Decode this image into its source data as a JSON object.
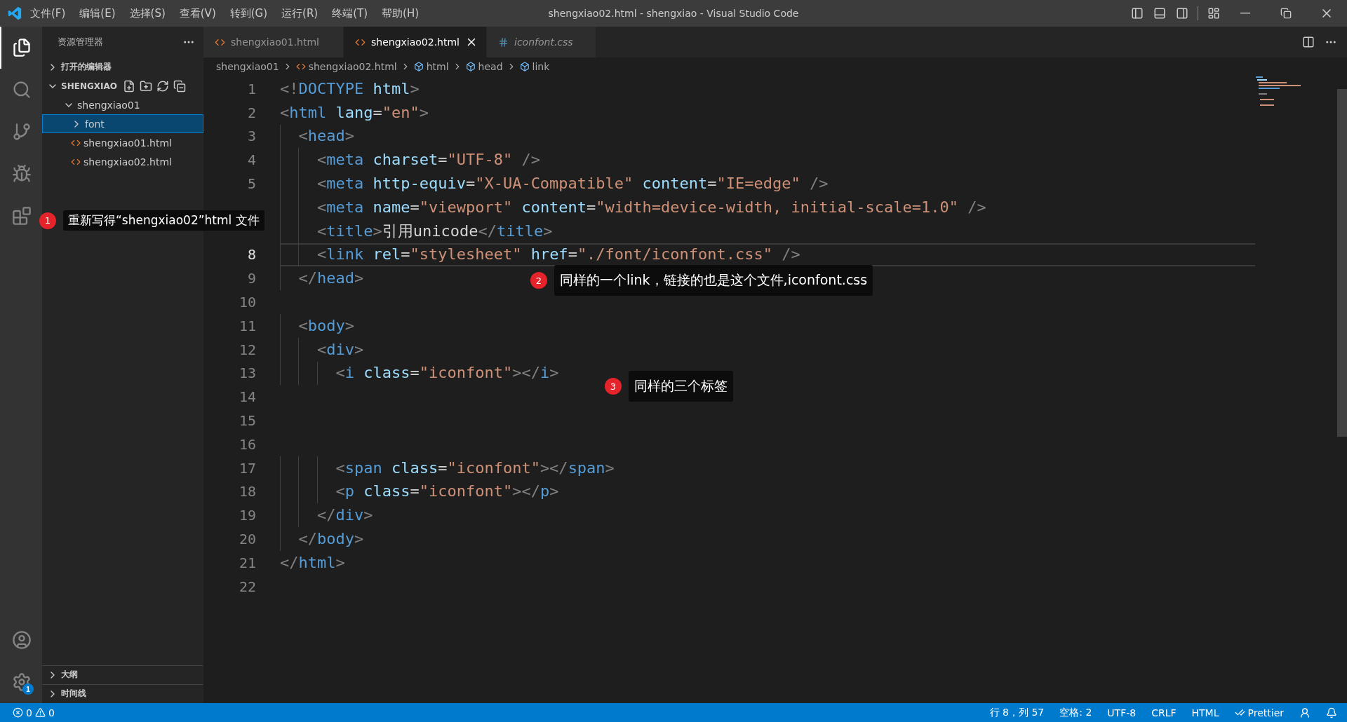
{
  "window": {
    "title": "shengxiao02.html - shengxiao - Visual Studio Code"
  },
  "menu": [
    "文件(F)",
    "编辑(E)",
    "选择(S)",
    "查看(V)",
    "转到(G)",
    "运行(R)",
    "终端(T)",
    "帮助(H)"
  ],
  "activity_bar": {
    "settings_badge": "1"
  },
  "sidebar": {
    "title": "资源管理器",
    "open_editors": {
      "label": "打开的编辑器",
      "expanded": false
    },
    "workspace": {
      "label": "SHENGXIAO",
      "expanded": true,
      "tree": [
        {
          "label": "shengxiao01",
          "kind": "folder",
          "expanded": true,
          "selected": false,
          "children": [
            {
              "label": "font",
              "kind": "folder",
              "expanded": false,
              "selected": true
            },
            {
              "label": "shengxiao01.html",
              "kind": "file",
              "selected": false
            },
            {
              "label": "shengxiao02.html",
              "kind": "file",
              "selected": false
            }
          ]
        }
      ]
    },
    "bottom_sections": [
      {
        "label": "大纲",
        "expanded": false
      },
      {
        "label": "时间线",
        "expanded": false
      }
    ]
  },
  "tabs": [
    {
      "label": "shengxiao01.html",
      "kind": "html",
      "selected": false,
      "preview": false
    },
    {
      "label": "shengxiao02.html",
      "kind": "html",
      "selected": true,
      "preview": false
    },
    {
      "label": "iconfont.css",
      "kind": "css",
      "selected": false,
      "preview": true
    }
  ],
  "breadcrumb": [
    {
      "label": "shengxiao01",
      "kind": "folder"
    },
    {
      "label": "shengxiao02.html",
      "kind": "file"
    },
    {
      "label": "html",
      "kind": "symbol"
    },
    {
      "label": "head",
      "kind": "symbol"
    },
    {
      "label": "link",
      "kind": "symbol"
    }
  ],
  "code_lines": [
    {
      "number": "1",
      "current": false,
      "tokens": [
        {
          "kind": "punct",
          "text": "<!"
        },
        {
          "kind": "tag",
          "text": "DOCTYPE"
        },
        {
          "kind": "attr",
          "text": " html"
        },
        {
          "kind": "punct",
          "text": ">"
        }
      ]
    },
    {
      "number": "2",
      "current": false,
      "tokens": [
        {
          "kind": "punct",
          "text": "<"
        },
        {
          "kind": "tag",
          "text": "html"
        },
        {
          "kind": "attr",
          "text": " lang"
        },
        {
          "kind": "text",
          "text": "="
        },
        {
          "kind": "string",
          "text": "\"en\""
        },
        {
          "kind": "punct",
          "text": ">"
        }
      ]
    },
    {
      "number": "3",
      "current": false,
      "tokens": [
        {
          "kind": "punct",
          "text": "  <"
        },
        {
          "kind": "tag",
          "text": "head"
        },
        {
          "kind": "punct",
          "text": ">"
        }
      ]
    },
    {
      "number": "4",
      "current": false,
      "tokens": [
        {
          "kind": "punct",
          "text": "    <"
        },
        {
          "kind": "tag",
          "text": "meta"
        },
        {
          "kind": "attr",
          "text": " charset"
        },
        {
          "kind": "text",
          "text": "="
        },
        {
          "kind": "string",
          "text": "\"UTF-8\""
        },
        {
          "kind": "punct",
          "text": " />"
        }
      ]
    },
    {
      "number": "5",
      "current": false,
      "tokens": [
        {
          "kind": "punct",
          "text": "    <"
        },
        {
          "kind": "tag",
          "text": "meta"
        },
        {
          "kind": "attr",
          "text": " http-equiv"
        },
        {
          "kind": "text",
          "text": "="
        },
        {
          "kind": "string",
          "text": "\"X-UA-Compatible\""
        },
        {
          "kind": "attr",
          "text": " content"
        },
        {
          "kind": "text",
          "text": "="
        },
        {
          "kind": "string",
          "text": "\"IE=edge\""
        },
        {
          "kind": "punct",
          "text": " />"
        }
      ]
    },
    {
      "current": false,
      "tokens": [
        {
          "kind": "punct",
          "text": "    <"
        },
        {
          "kind": "tag",
          "text": "meta"
        },
        {
          "kind": "attr",
          "text": " name"
        },
        {
          "kind": "text",
          "text": "="
        },
        {
          "kind": "string",
          "text": "\"viewport\""
        },
        {
          "kind": "attr",
          "text": " content"
        },
        {
          "kind": "text",
          "text": "="
        },
        {
          "kind": "string",
          "text": "\"width=device-width, initial-scale=1.0\""
        },
        {
          "kind": "punct",
          "text": " />"
        }
      ]
    },
    {
      "current": false,
      "tokens": [
        {
          "kind": "punct",
          "text": "    <"
        },
        {
          "kind": "tag",
          "text": "title"
        },
        {
          "kind": "punct",
          "text": ">"
        },
        {
          "kind": "text",
          "text": "引用unicode"
        },
        {
          "kind": "punct",
          "text": "</"
        },
        {
          "kind": "tag",
          "text": "title"
        },
        {
          "kind": "punct",
          "text": ">"
        }
      ]
    },
    {
      "number": "8",
      "current": true,
      "tokens": [
        {
          "kind": "punct",
          "text": "    <"
        },
        {
          "kind": "tag",
          "text": "link"
        },
        {
          "kind": "attr",
          "text": " rel"
        },
        {
          "kind": "text",
          "text": "="
        },
        {
          "kind": "string",
          "text": "\"stylesheet\""
        },
        {
          "kind": "attr",
          "text": " href"
        },
        {
          "kind": "text",
          "text": "="
        },
        {
          "kind": "string",
          "text": "\"./font/iconfont.css\""
        },
        {
          "kind": "punct",
          "text": " />"
        }
      ]
    },
    {
      "number": "9",
      "current": false,
      "tokens": [
        {
          "kind": "punct",
          "text": "  </"
        },
        {
          "kind": "tag",
          "text": "head"
        },
        {
          "kind": "punct",
          "text": ">"
        }
      ]
    },
    {
      "number": "10",
      "current": false
    },
    {
      "number": "11",
      "current": false,
      "tokens": [
        {
          "kind": "punct",
          "text": "  <"
        },
        {
          "kind": "tag",
          "text": "body"
        },
        {
          "kind": "punct",
          "text": ">"
        }
      ]
    },
    {
      "number": "12",
      "current": false,
      "tokens": [
        {
          "kind": "punct",
          "text": "    <"
        },
        {
          "kind": "tag",
          "text": "div"
        },
        {
          "kind": "punct",
          "text": ">"
        }
      ]
    },
    {
      "number": "13",
      "current": false,
      "tokens": [
        {
          "kind": "punct",
          "text": "      <"
        },
        {
          "kind": "tag",
          "text": "i"
        },
        {
          "kind": "attr",
          "text": " class"
        },
        {
          "kind": "text",
          "text": "="
        },
        {
          "kind": "string",
          "text": "\"iconfont\""
        },
        {
          "kind": "punct",
          "text": "></"
        },
        {
          "kind": "tag",
          "text": "i"
        },
        {
          "kind": "punct",
          "text": ">"
        }
      ]
    },
    {
      "number": "14",
      "current": false
    },
    {
      "number": "15",
      "current": false
    },
    {
      "number": "16",
      "current": false
    },
    {
      "number": "17",
      "current": false,
      "tokens": [
        {
          "kind": "punct",
          "text": "      <"
        },
        {
          "kind": "tag",
          "text": "span"
        },
        {
          "kind": "attr",
          "text": " class"
        },
        {
          "kind": "text",
          "text": "="
        },
        {
          "kind": "string",
          "text": "\"iconfont\""
        },
        {
          "kind": "punct",
          "text": "></"
        },
        {
          "kind": "tag",
          "text": "span"
        },
        {
          "kind": "punct",
          "text": ">"
        }
      ]
    },
    {
      "number": "18",
      "current": false,
      "tokens": [
        {
          "kind": "punct",
          "text": "      <"
        },
        {
          "kind": "tag",
          "text": "p"
        },
        {
          "kind": "attr",
          "text": " class"
        },
        {
          "kind": "text",
          "text": "="
        },
        {
          "kind": "string",
          "text": "\"iconfont\""
        },
        {
          "kind": "punct",
          "text": "></"
        },
        {
          "kind": "tag",
          "text": "p"
        },
        {
          "kind": "punct",
          "text": ">"
        }
      ]
    },
    {
      "number": "19",
      "current": false,
      "tokens": [
        {
          "kind": "punct",
          "text": "    </"
        },
        {
          "kind": "tag",
          "text": "div"
        },
        {
          "kind": "punct",
          "text": ">"
        }
      ]
    },
    {
      "number": "20",
      "current": false,
      "tokens": [
        {
          "kind": "punct",
          "text": "  </"
        },
        {
          "kind": "tag",
          "text": "body"
        },
        {
          "kind": "punct",
          "text": ">"
        }
      ]
    },
    {
      "number": "21",
      "current": false,
      "tokens": [
        {
          "kind": "punct",
          "text": "</"
        },
        {
          "kind": "tag",
          "text": "html"
        },
        {
          "kind": "punct",
          "text": ">"
        }
      ]
    },
    {
      "number": "22",
      "current": false
    }
  ],
  "annotations": [
    {
      "badge": "1",
      "text": "重新写得“shengxiao02”html 文件"
    },
    {
      "badge": "2",
      "text": "同样的一个link，链接的也是这个文件,iconfont.css"
    },
    {
      "badge": "3",
      "text": "同样的三个标签"
    }
  ],
  "status_bar": {
    "errors": "0",
    "warnings": "0",
    "items": [
      {
        "kind": "text",
        "text": "行 8，列 57"
      },
      {
        "kind": "text",
        "text": "空格: 2"
      },
      {
        "kind": "text",
        "text": "UTF-8"
      },
      {
        "kind": "text",
        "text": "CRLF"
      },
      {
        "kind": "text",
        "text": "HTML"
      },
      {
        "kind": "formatter",
        "text": "Prettier"
      }
    ]
  }
}
